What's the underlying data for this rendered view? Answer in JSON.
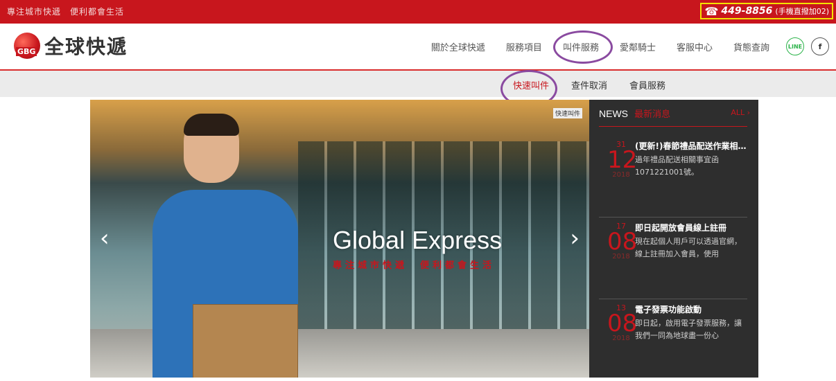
{
  "topbar": {
    "slogan": "專注城市快遞　便利都會生活",
    "phone_icon": "phone-icon",
    "phone_number": "449-8856",
    "phone_note": "(手機直撥加02)"
  },
  "header": {
    "logo_badge": "GBG",
    "logo_name": "全球快遞",
    "nav": [
      "關於全球快遞",
      "服務項目",
      "叫件服務",
      "愛鄰騎士",
      "客服中心",
      "貨態查詢"
    ],
    "social": [
      "LINE",
      "f"
    ]
  },
  "subnav": {
    "items": [
      "快速叫件",
      "查件取消",
      "會員服務"
    ]
  },
  "hero": {
    "title": "Global Express",
    "subtitle": "專注城市快遞　便利都會生活",
    "tag": "快速叫件",
    "prev": "‹",
    "next": "›"
  },
  "news": {
    "title_en": "NEWS",
    "title_zh": "最新消息",
    "all_label": "ALL ›",
    "entries": [
      {
        "day": "31",
        "month": "12",
        "year": "2018",
        "title": "(更新!)春節禮品配送作業相...",
        "desc": "過年禮品配送相關事宜函 1071221001號。"
      },
      {
        "day": "17",
        "month": "08",
        "year": "2018",
        "title": "即日起開放會員線上註冊",
        "desc": "現在起個人用戶可以透過官網，線上註冊加入會員，使用"
      },
      {
        "day": "13",
        "month": "08",
        "year": "2018",
        "title": "電子發票功能啟動",
        "desc": "即日起，啟用電子發票服務，讓我們一同為地球盡一份心"
      }
    ]
  }
}
